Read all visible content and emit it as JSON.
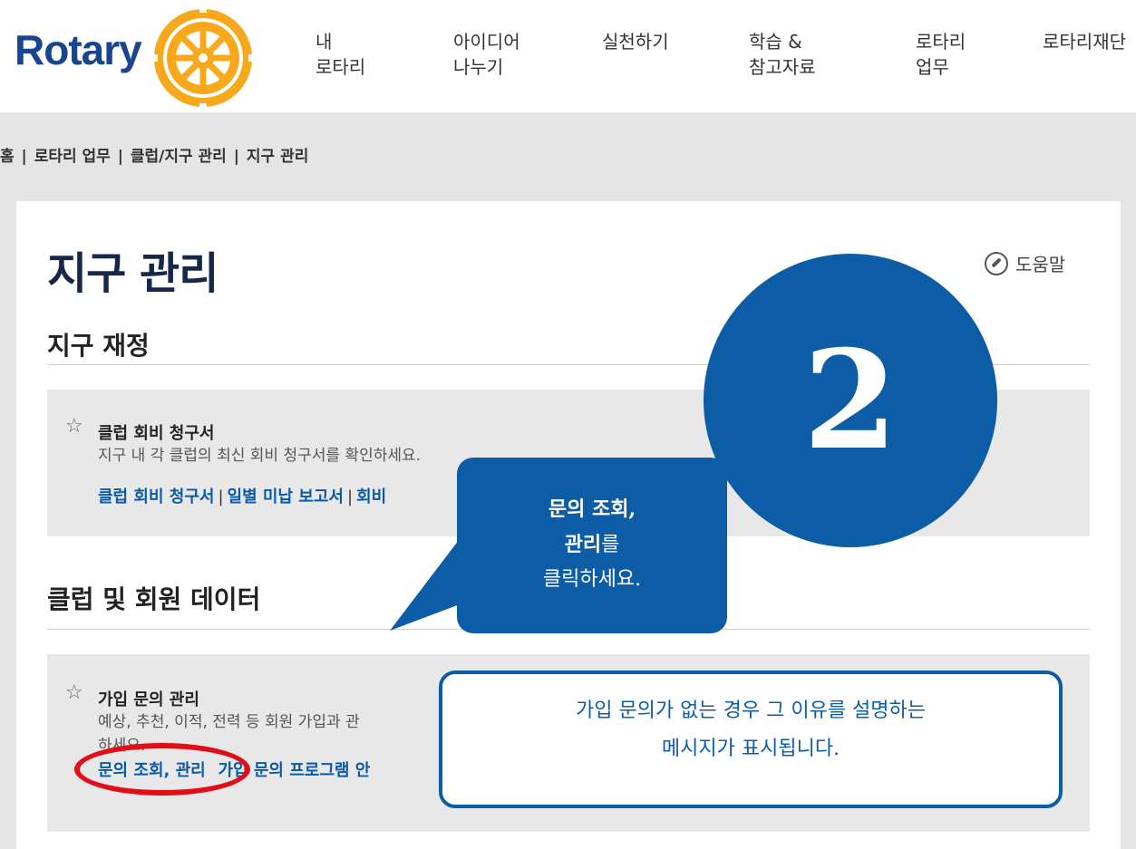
{
  "header": {
    "logo_text": "Rotary",
    "nav": [
      {
        "line1": "내",
        "line2": "로타리"
      },
      {
        "line1": "아이디어",
        "line2": "나누기"
      },
      {
        "line1": "실천하기",
        "line2": ""
      },
      {
        "line1": "학습 &",
        "line2": "참고자료"
      },
      {
        "line1": "로타리",
        "line2": "업무"
      },
      {
        "line1": "로타리재단",
        "line2": ""
      }
    ]
  },
  "breadcrumb": [
    "홈",
    "로타리 업무",
    "클럽/지구 관리",
    "지구 관리"
  ],
  "page": {
    "title": "지구 관리",
    "help_label": "도움말"
  },
  "sections": {
    "finance": {
      "heading": "지구 재정",
      "item_title": "클럽 회비 청구서",
      "item_desc": "지구 내 각 클럽의 최신 회비 청구서를 확인하세요.",
      "links": [
        "클럽 회비 청구서",
        "일별 미납 보고서",
        "회비"
      ]
    },
    "data": {
      "heading": "클럽 및 회원 데이터",
      "item_title": "가입 문의 관리",
      "item_desc_line1": "예상, 추천, 이적, 전력 등 회원 가입과 관",
      "item_desc_line2": "하세요.",
      "links": [
        "문의 조회, 관리",
        "가입 문의 프로그램 안"
      ]
    }
  },
  "overlays": {
    "step_number": "2",
    "callout_line1": "문의 조회,",
    "callout_line2_bold": "관리",
    "callout_line2_rest": "를",
    "callout_line3": "클릭하세요.",
    "info_line1": "가입 문의가 없는 경우 그 이유를 설명하는",
    "info_line2": "메시지가 표시됩니다."
  },
  "colors": {
    "brand_blue": "#17458f",
    "link_blue": "#0b5aa6",
    "overlay_blue": "#0d5ca6",
    "rotary_gold": "#f7a81b",
    "highlight_red": "#e20e17"
  }
}
